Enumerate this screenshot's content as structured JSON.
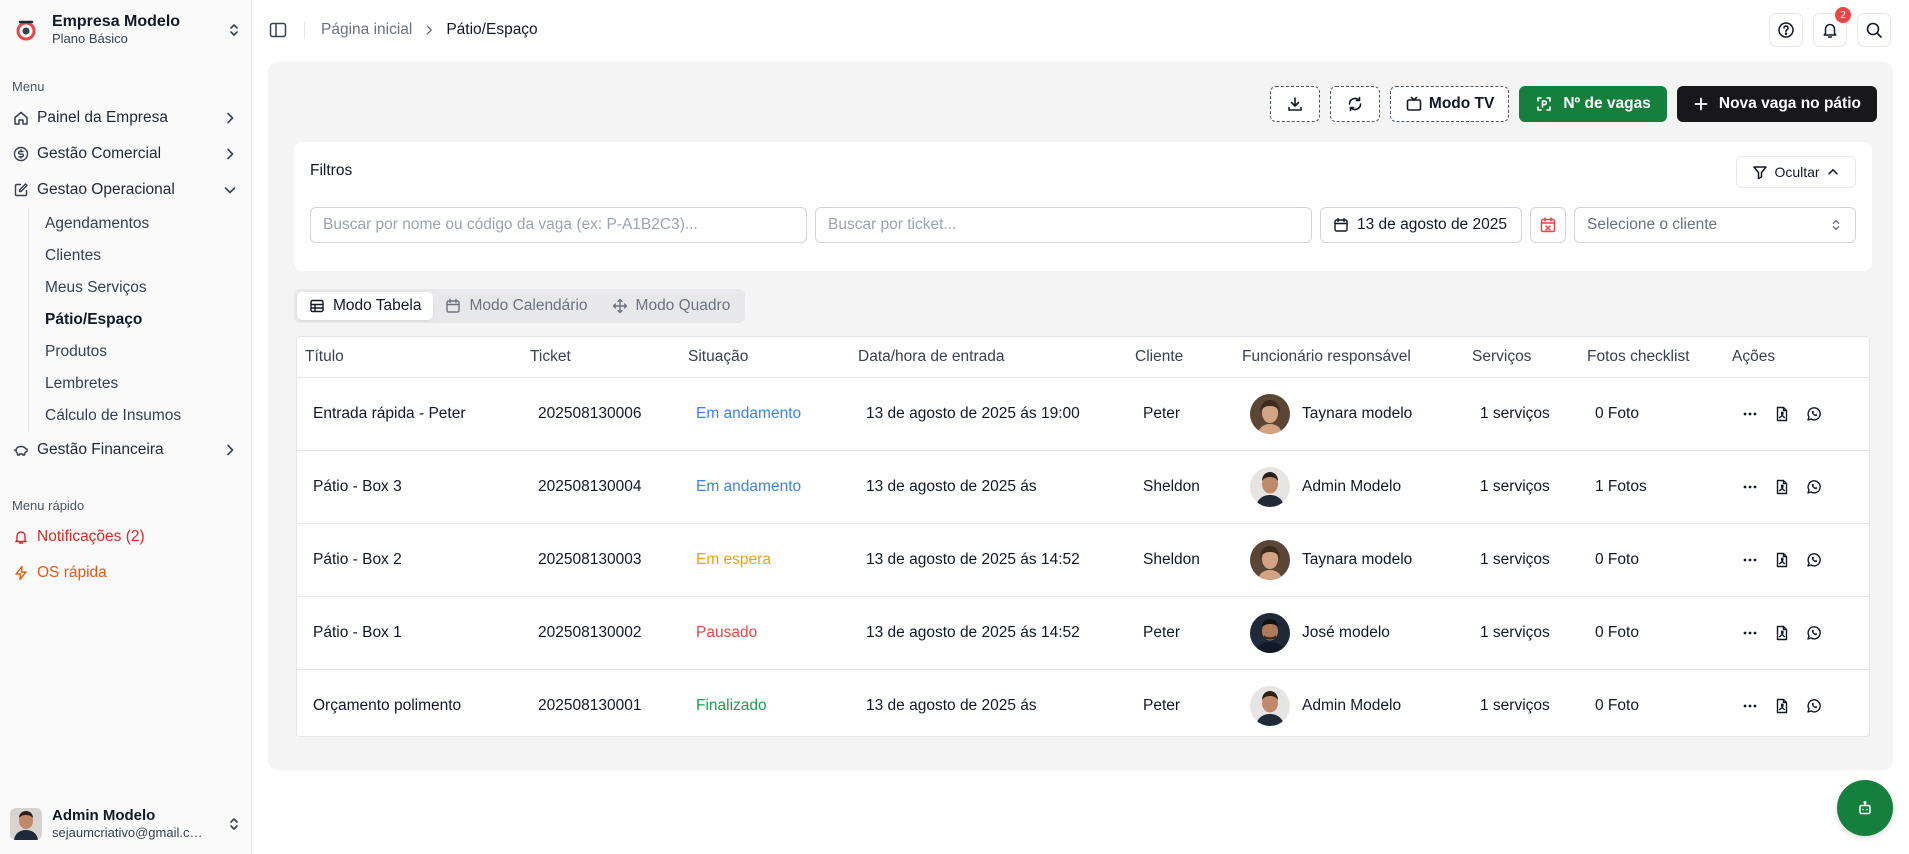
{
  "company": {
    "name": "Empresa Modelo",
    "plan": "Plano Básico"
  },
  "sidebar": {
    "menu_label": "Menu",
    "items": [
      {
        "label": "Painel da Empresa",
        "icon": "home-icon"
      },
      {
        "label": "Gestão Comercial",
        "icon": "dollar-circle-icon"
      },
      {
        "label": "Gestao Operacional",
        "icon": "clipboard-edit-icon"
      },
      {
        "label": "Gestão Financeira",
        "icon": "piggy-bank-icon"
      }
    ],
    "subitems": [
      "Agendamentos",
      "Clientes",
      "Meus Serviços",
      "Pátio/Espaço",
      "Produtos",
      "Lembretes",
      "Cálculo de Insumos"
    ],
    "quick_label": "Menu rápido",
    "quick": [
      {
        "label": "Notificações (2)",
        "icon": "bell-icon",
        "color": "#dc2626"
      },
      {
        "label": "OS rápida",
        "icon": "lightning-icon",
        "color": "#ea580c"
      }
    ]
  },
  "user": {
    "name": "Admin Modelo",
    "email": "sejaumcriativo@gmail.com"
  },
  "breadcrumb": {
    "home": "Página inicial",
    "current": "Pátio/Espaço"
  },
  "topbar": {
    "notification_count": "2"
  },
  "actions": {
    "tv_mode": "Modo TV",
    "spots": "Nº de vagas",
    "new_spot": "Nova vaga no pátio"
  },
  "filters": {
    "title": "Filtros",
    "hide_label": "Ocultar",
    "search_placeholder": "Buscar por nome ou código da vaga (ex: P-A1B2C3)...",
    "ticket_placeholder": "Buscar por ticket...",
    "date": "13 de agosto de 2025",
    "client_placeholder": "Selecione o cliente"
  },
  "tabs": [
    "Modo Tabela",
    "Modo Calendário",
    "Modo Quadro"
  ],
  "table": {
    "headers": [
      "Título",
      "Ticket",
      "Situação",
      "Data/hora de entrada",
      "Cliente",
      "Funcionário responsável",
      "Serviços",
      "Fotos checklist",
      "Ações"
    ],
    "rows": [
      {
        "title": "Entrada rápida - Peter",
        "ticket": "202508130006",
        "status": "Em andamento",
        "status_color": "#3b82f6",
        "entry": "13 de agosto de 2025 ás 19:00",
        "client": "Peter",
        "employee": "Taynara modelo",
        "services": "1 serviços",
        "photos": "0 Foto"
      },
      {
        "title": "Pátio - Box 3",
        "ticket": "202508130004",
        "status": "Em andamento",
        "status_color": "#3b82f6",
        "entry": "13 de agosto de 2025 ás",
        "client": "Sheldon",
        "employee": "Admin Modelo",
        "services": "1 serviços",
        "photos": "1 Fotos"
      },
      {
        "title": "Pátio - Box 2",
        "ticket": "202508130003",
        "status": "Em espera",
        "status_color": "#f59e0b",
        "entry": "13 de agosto de 2025 ás 14:52",
        "client": "Sheldon",
        "employee": "Taynara modelo",
        "services": "1 serviços",
        "photos": "0 Foto"
      },
      {
        "title": "Pátio - Box 1",
        "ticket": "202508130002",
        "status": "Pausado",
        "status_color": "#ef4444",
        "entry": "13 de agosto de 2025 ás 14:52",
        "client": "Peter",
        "employee": "José modelo",
        "services": "1 serviços",
        "photos": "0 Foto"
      },
      {
        "title": "Orçamento polimento",
        "ticket": "202508130001",
        "status": "Finalizado",
        "status_color": "#16a34a",
        "entry": "13 de agosto de 2025 ás",
        "client": "Peter",
        "employee": "Admin Modelo",
        "services": "1 serviços",
        "photos": "0 Foto"
      }
    ]
  },
  "colors": {
    "primary_green": "#15803d",
    "dark": "#18181b",
    "panel_bg": "#f4f4f5"
  }
}
